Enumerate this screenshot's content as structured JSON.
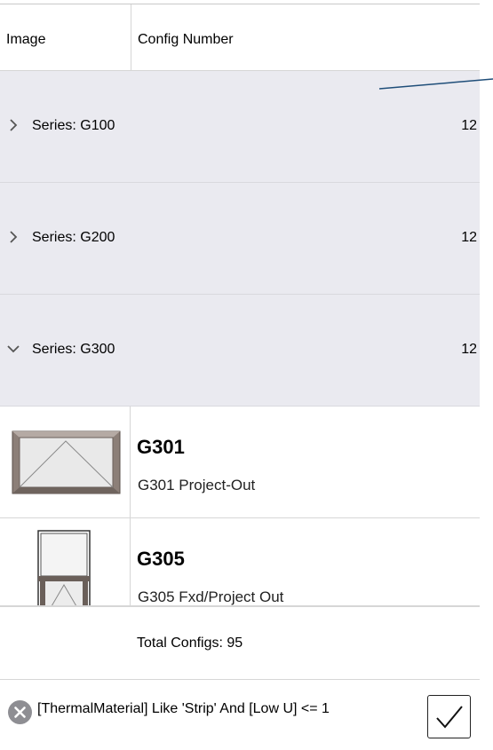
{
  "header": {
    "image_col": "Image",
    "config_col": "Config Number"
  },
  "groups": [
    {
      "label": "Series: G100",
      "count": "12",
      "expanded": false
    },
    {
      "label": "Series: G200",
      "count": "12",
      "expanded": false
    },
    {
      "label": "Series: G300",
      "count": "12",
      "expanded": true
    }
  ],
  "configs": [
    {
      "code": "G301",
      "description": "G301 Project-Out",
      "thumbnail": "project-out-window-icon"
    },
    {
      "code": "G305",
      "description": "G305 Fxd/Project Out",
      "thumbnail": "fixed-project-out-window-icon"
    }
  ],
  "total": "Total Configs: 95",
  "filter": {
    "text": "[ThermalMaterial] Like 'Strip' And [Low U] <= 1",
    "clear_icon": "clear-filter-icon",
    "apply_icon": "checkmark-icon"
  },
  "colors": {
    "group_bg": "#eaeaf0",
    "divider": "#d6d6d6",
    "annotation_line": "#1f4e79"
  }
}
